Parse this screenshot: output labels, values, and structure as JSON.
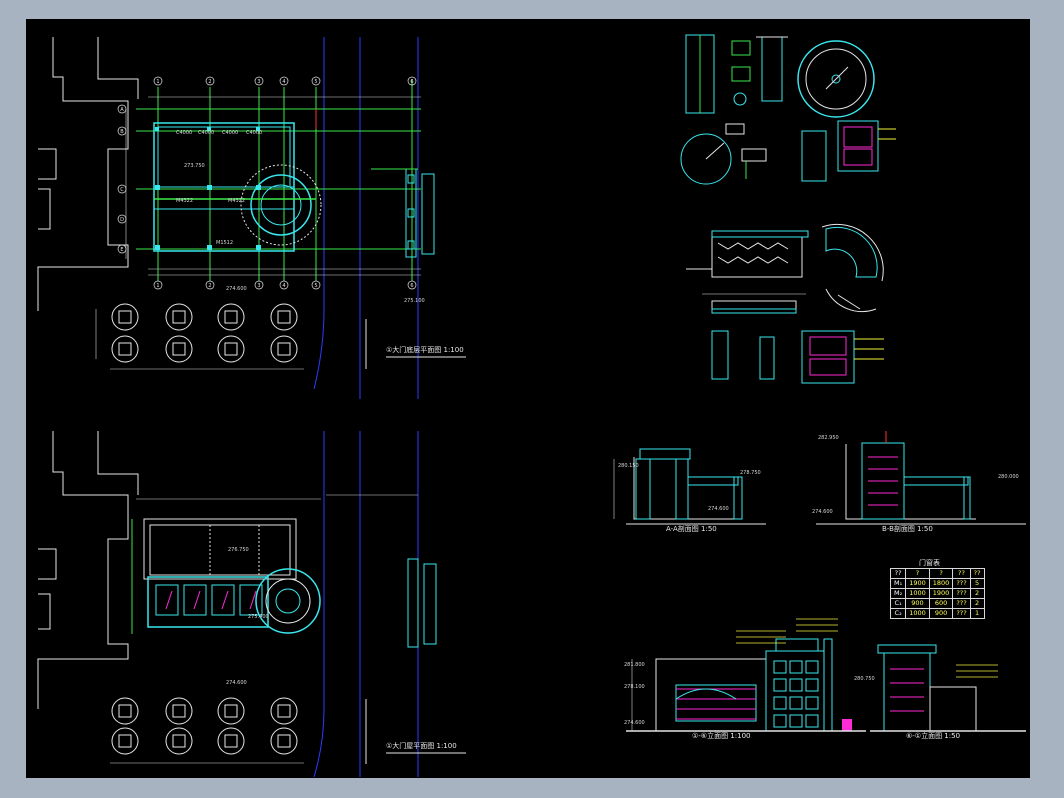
{
  "colors": {
    "background": "#a8b3c2",
    "canvas": "#000000",
    "wall": "#39e7ee",
    "axis": "#3ce84a",
    "road": "#2a3cff",
    "annotation": "#f2f23a",
    "accent": "#ff2bd6",
    "text": "#e8e8e8"
  },
  "drawing_titles": {
    "ground_floor_plan": "①大门底层平面图  1:100",
    "roof_plan": "①大门屋平面图  1:100",
    "section_aa": "A-A剖面图  1:50",
    "section_bb": "B-B剖面图  1:50",
    "elevation_front": "①-⑥立面图  1:100",
    "elevation_side": "⑥-①立面图  1:50",
    "door_window_table_title": "门窗表"
  },
  "room_labels": {
    "plan_m1": "M4322",
    "plan_m2": "M4322",
    "plan_c1": "C4000",
    "plan_c2": "C4000",
    "plan_c3": "C4000",
    "plan_c4": "C4000",
    "plan_room": "273.750",
    "plan_mc": "M1512"
  },
  "level_marks": {
    "plan_level_a": "274.600",
    "plan_level_b": "275.100",
    "roof_level_a": "276.750",
    "roof_level_b": "275.400",
    "roof_level_c": "274.600",
    "sec_a_top": "280.150",
    "sec_a_mid": "278.750",
    "sec_a_base": "274.600",
    "sec_b_top": "282.950",
    "sec_b_mid": "280.000",
    "sec_b_base": "274.600",
    "elev_top": "281.800",
    "elev_mid": "278.100",
    "elev_base": "274.600",
    "elev_side_mid": "280.750"
  },
  "axis_numbers": [
    "1",
    "2",
    "3",
    "4",
    "5",
    "6"
  ],
  "axis_letters": [
    "A",
    "B",
    "C",
    "D",
    "E"
  ],
  "door_window_table": {
    "header": [
      "??",
      "?",
      "?",
      "??",
      "??"
    ],
    "rows": [
      [
        "M₁",
        "1900",
        "1800",
        "???",
        "5"
      ],
      [
        "M₂",
        "1000",
        "1900",
        "???",
        "2"
      ],
      [
        "C₁",
        "900",
        "600",
        "???",
        "2"
      ],
      [
        "C₂",
        "1000",
        "900",
        "???",
        "1"
      ]
    ]
  }
}
